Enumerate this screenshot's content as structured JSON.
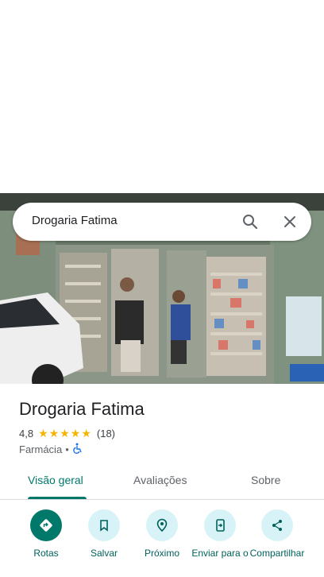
{
  "search": {
    "value": "Drogaria Fatima"
  },
  "place": {
    "title": "Drogaria Fatima",
    "rating": "4,8",
    "stars": [
      "★",
      "★",
      "★",
      "★",
      "★"
    ],
    "review_count": "(18)",
    "category": "Farmácia",
    "separator": "•"
  },
  "tabs": [
    {
      "label": "Visão geral",
      "active": true
    },
    {
      "label": "Avaliações",
      "active": false
    },
    {
      "label": "Sobre",
      "active": false
    }
  ],
  "actions": [
    {
      "label": "Rotas",
      "icon": "directions-icon"
    },
    {
      "label": "Salvar",
      "icon": "bookmark-icon"
    },
    {
      "label": "Próximo",
      "icon": "nearby-icon"
    },
    {
      "label": "Enviar para o",
      "icon": "send-to-phone-icon"
    },
    {
      "label": "Compartilhar",
      "icon": "share-icon"
    }
  ],
  "colors": {
    "accent": "#00796b",
    "star": "#f4b400",
    "action_bg": "#d8f3f7"
  }
}
